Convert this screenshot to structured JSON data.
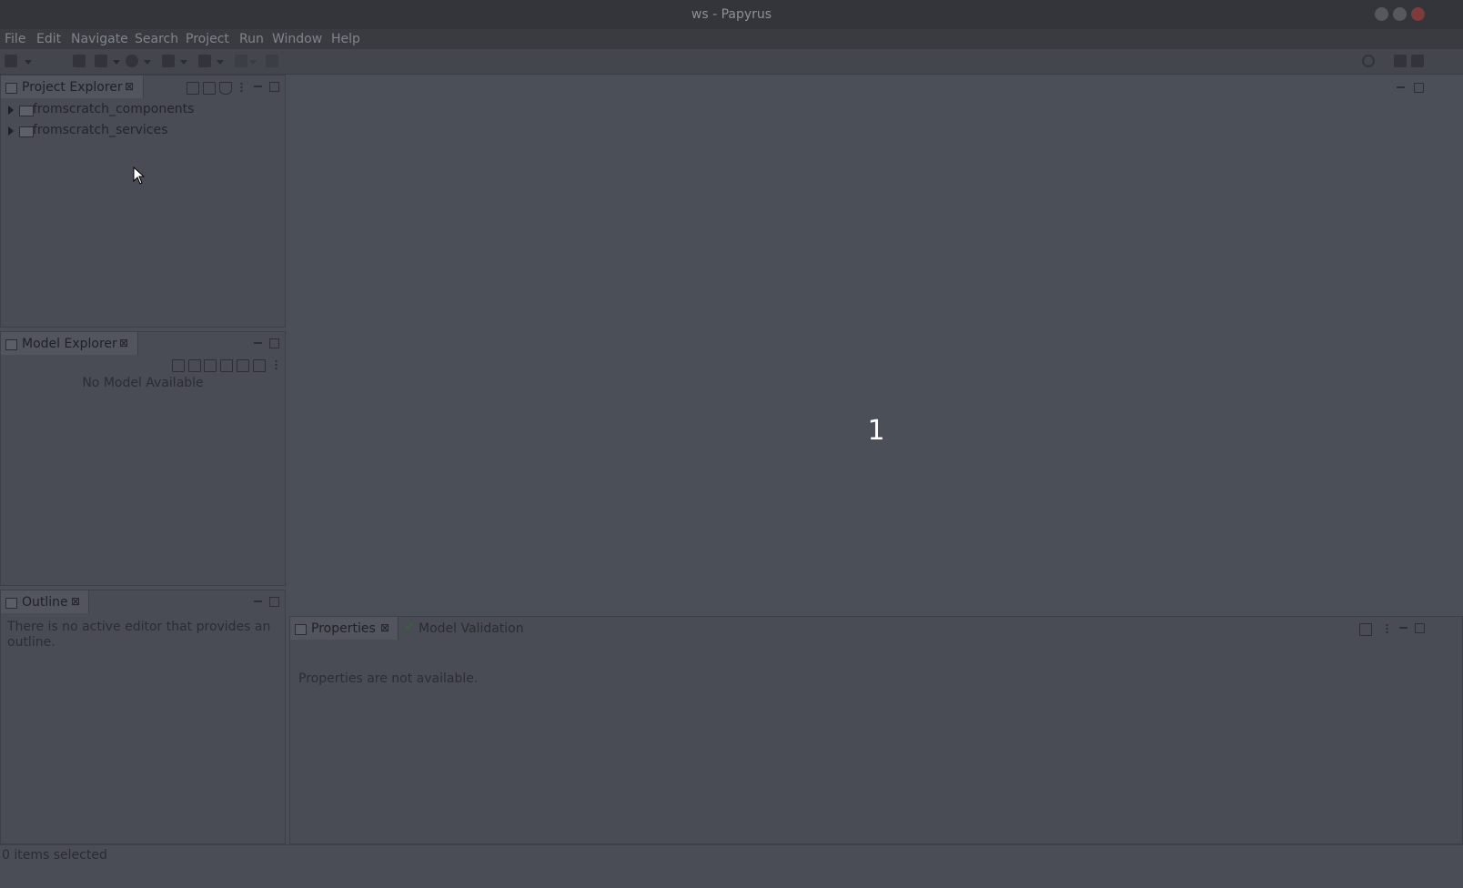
{
  "window": {
    "title": "ws - Papyrus",
    "colors": {
      "titlebar": "#33353a",
      "close": "#7e3b3a"
    }
  },
  "menu": {
    "items": [
      "File",
      "Edit",
      "Navigate",
      "Search",
      "Project",
      "Run",
      "Window",
      "Help"
    ]
  },
  "project_explorer": {
    "tab_label": "Project Explorer",
    "close_symbol": "⊠",
    "items": [
      {
        "label": "fromscratch_components",
        "icon": "folder-icon",
        "expanded": false
      },
      {
        "label": "fromscratch_services",
        "icon": "folder-icon",
        "expanded": false
      }
    ]
  },
  "model_explorer": {
    "tab_label": "Model Explorer",
    "close_symbol": "⊠",
    "message": "No Model Available"
  },
  "outline": {
    "tab_label": "Outline",
    "close_symbol": "⊠",
    "message": "There is no active editor that provides an outline."
  },
  "editor": {
    "overlay_text": "1"
  },
  "properties": {
    "tab_label": "Properties",
    "close_symbol": "⊠",
    "secondary_tab_label": "Model Validation",
    "message": "Properties are not available."
  },
  "status": {
    "text": "0 items selected"
  },
  "icons": {
    "toolbar": [
      "new-icon",
      "save-icon",
      "debug-icon",
      "run-icon",
      "external-tools-icon",
      "back-icon",
      "forward-icon",
      "search-icon",
      "perspective-icon"
    ]
  }
}
